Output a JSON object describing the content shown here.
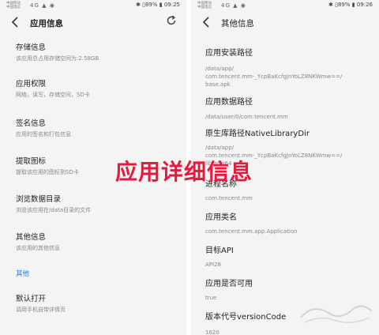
{
  "left": {
    "status": {
      "carrier_line1": "中国移动",
      "carrier_line2": "中国电信",
      "signal": "4G ▲ ◉",
      "right": "✱ ▯89% ▮ 09:25"
    },
    "header": {
      "title": "应用信息",
      "back_icon": "back-arrow-icon",
      "refresh_icon": "refresh-icon"
    },
    "items": [
      {
        "title": "存储信息",
        "sub": "该应用总占用存储空间为:2.58GB"
      },
      {
        "title": "应用权限",
        "sub": "网络，读写，存储空间，SD卡"
      },
      {
        "title": "签名信息",
        "sub": "应用的签名和打包信息"
      },
      {
        "title": "提取图标",
        "sub": "提取该应用的图标到SD卡"
      },
      {
        "title": "浏览数据目录",
        "sub": "浏览该应用在/data目录的文件"
      },
      {
        "title": "其他信息",
        "sub": "该应用的其他信息"
      }
    ],
    "section": "其他",
    "extra_items": [
      {
        "title": "默认打开",
        "sub": "调用手机自带详情页"
      }
    ]
  },
  "right": {
    "status": {
      "carrier_line1": "中国移动",
      "carrier_line2": "中国电信",
      "signal": "4G ▲ ◉",
      "right": "✱ ▯89% ▮ 09:26"
    },
    "header": {
      "title": "其他信息",
      "back_icon": "back-arrow-icon"
    },
    "items": [
      {
        "title": "应用安装路径",
        "value_lines": [
          "/data/app/",
          "com.tencent.mm-_YcpBaKcfgJnYoLZ8NKWmw==/",
          "base.apk"
        ]
      },
      {
        "title": "应用数据路径",
        "value_lines": [
          "/data/user/0/com.tencent.mm"
        ]
      },
      {
        "title": "原生库路径NativeLibraryDir",
        "value_lines": [
          "/data/app/",
          "com.tencent.mm-_YcpBaKcfgJnYoLZ8NKWmw==/",
          "lib/arm64"
        ]
      },
      {
        "title": "进程名称",
        "value_lines": [
          "com.tencent.mm"
        ]
      },
      {
        "title": "应用类名",
        "value_lines": [
          "com.tencent.mm.app.Application"
        ]
      },
      {
        "title": "目标API",
        "value_lines": [
          "API28"
        ]
      },
      {
        "title": "应用是否可用",
        "value_lines": [
          "true"
        ]
      },
      {
        "title": "版本代号versionCode",
        "value_lines": [
          "1620"
        ]
      }
    ]
  },
  "overlay": {
    "text": "应用详细信息",
    "color": "#e8193c"
  },
  "colors": {
    "accent": "#2a79d6",
    "background": "#f4f4f4",
    "overlay_red": "#e8193c"
  }
}
